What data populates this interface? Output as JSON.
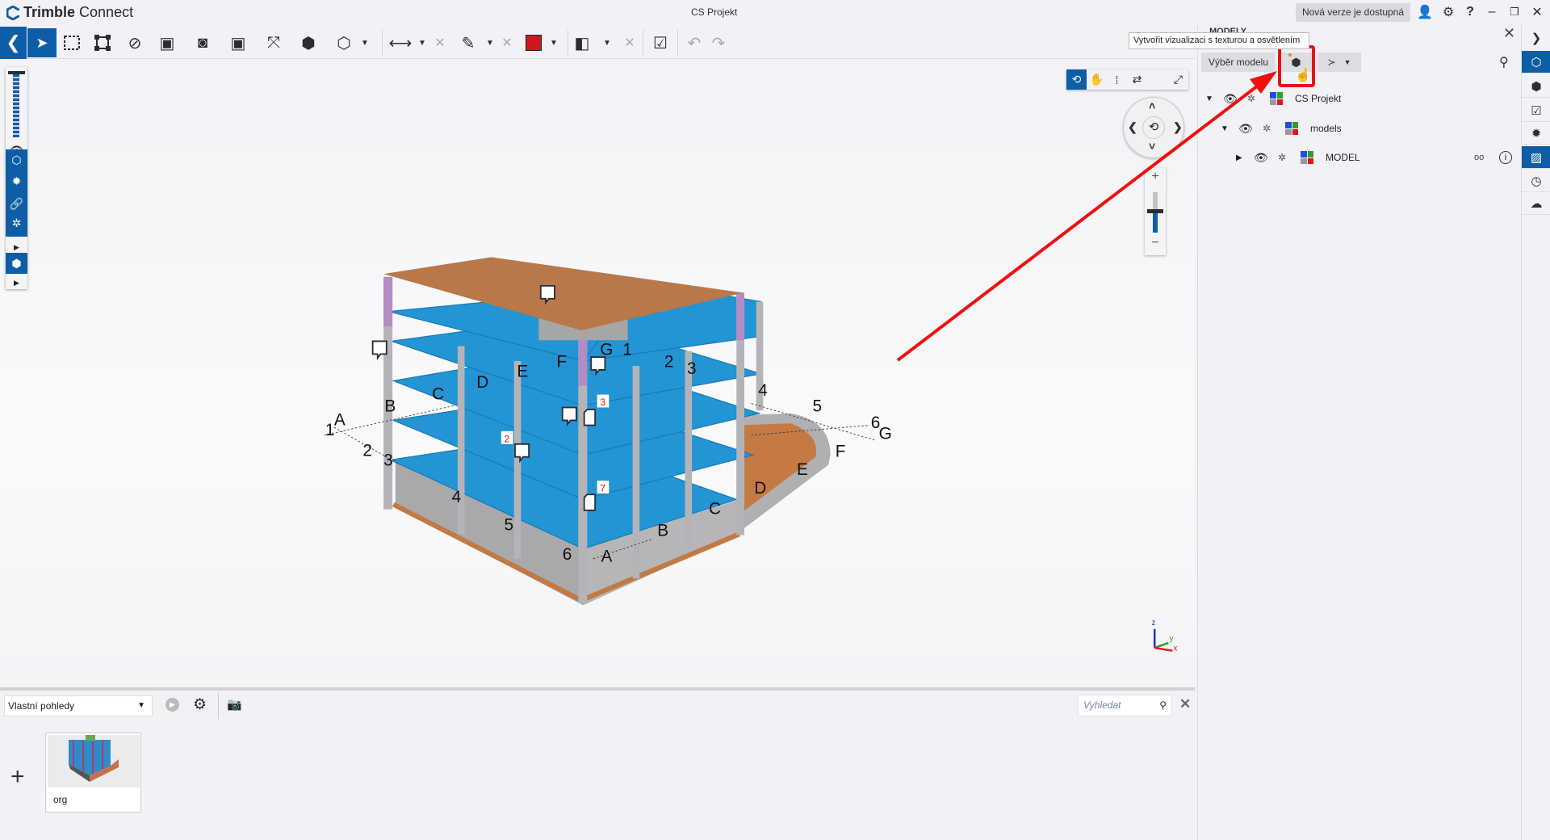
{
  "app": {
    "name_bold": "Trimble",
    "name_rest": " Connect",
    "project_title": "CS Projekt",
    "new_version": "Nová verze je dostupná"
  },
  "window_controls": {
    "minimize": "–",
    "restore": "❐",
    "close": "✕"
  },
  "toolbar": {
    "icons": [
      "back",
      "select",
      "rectangle-select",
      "box-select",
      "hide",
      "isolate",
      "ghost",
      "show-only",
      "fit",
      "object-info",
      "view-cube",
      "measure",
      "clear-measure",
      "markup-pen",
      "clear-markup",
      "color-red",
      "section",
      "clear-section",
      "checklist",
      "undo",
      "redo"
    ],
    "markup_color": "#d0161e"
  },
  "viewer": {
    "grid_labels": [
      "A",
      "1",
      "B",
      "2",
      "3",
      "C",
      "D",
      "E",
      "F",
      "G",
      "1",
      "2",
      "3",
      "4",
      "5",
      "6",
      "G",
      "F",
      "E",
      "D",
      "C",
      "B",
      "A",
      "6",
      "5",
      "4"
    ],
    "markers": [
      "3",
      "2",
      "7"
    ],
    "axis": {
      "z": "z",
      "y": "y",
      "x": "x"
    }
  },
  "panel": {
    "title": "MODELY",
    "tooltip": "Vytvořit vizualizaci s texturou a osvětlením",
    "model_select": "Výběr modelu",
    "tree": [
      {
        "label": "CS Projekt"
      },
      {
        "label": "models"
      },
      {
        "label": "MODEL"
      }
    ]
  },
  "bottom": {
    "views_select": "Vlastní pohledy",
    "search_placeholder": "Vyhledat",
    "add": "+",
    "views": [
      {
        "name": "org"
      }
    ]
  },
  "colors": {
    "accent": "#0d5ea6",
    "highlight": "#e5141b",
    "slab": "#2196d3",
    "roof": "#b8784a"
  }
}
